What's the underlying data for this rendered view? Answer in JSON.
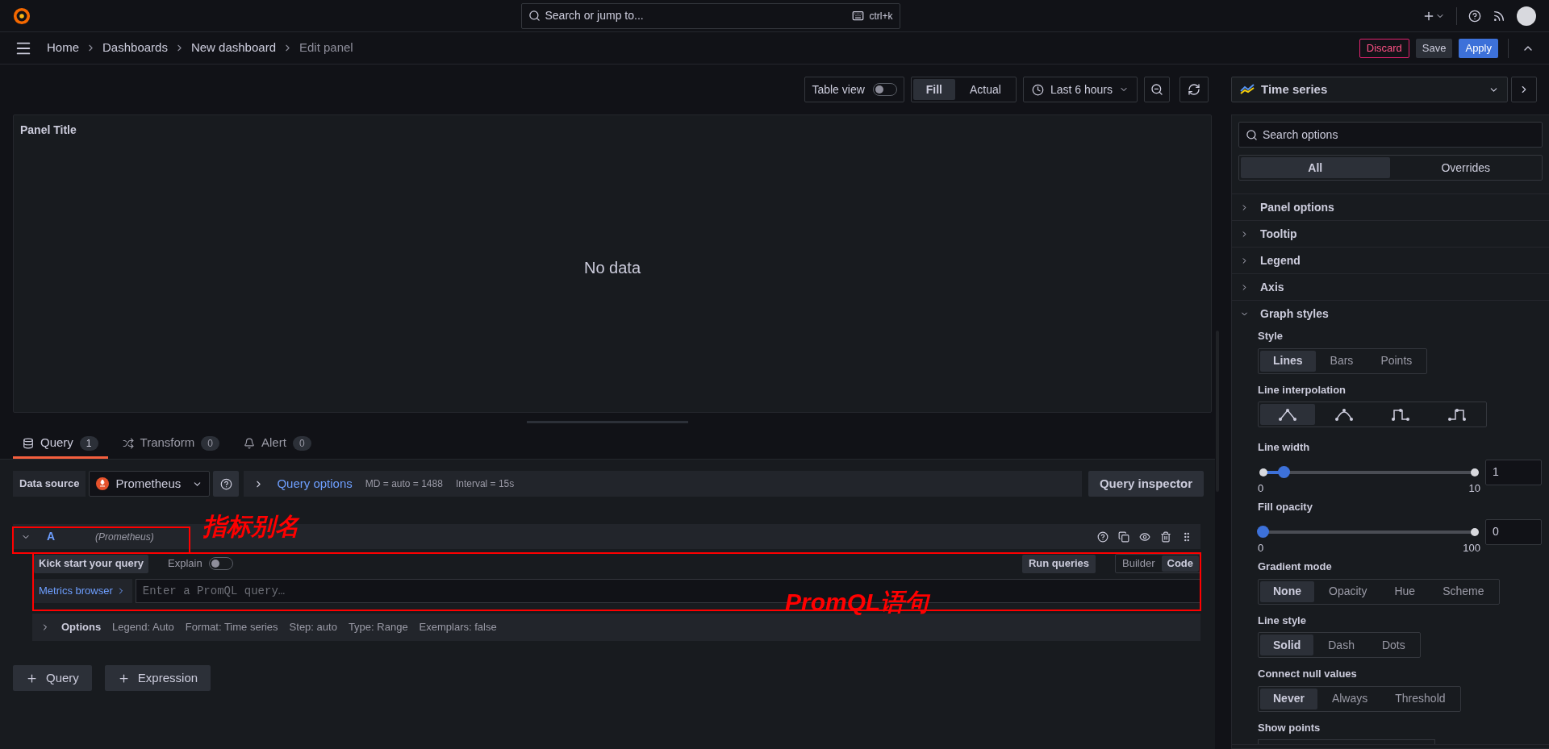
{
  "topbar": {
    "search_placeholder": "Search or jump to...",
    "shortcut": "ctrl+k"
  },
  "breadcrumb": [
    "Home",
    "Dashboards",
    "New dashboard",
    "Edit panel"
  ],
  "actions": [
    {
      "label": "Discard",
      "kind": "danger"
    },
    {
      "label": "Save",
      "kind": "secondary"
    },
    {
      "label": "Apply",
      "kind": "primary"
    }
  ],
  "toolbar": {
    "table_view": {
      "label": "Table view",
      "on": false
    },
    "fill_modes": [
      {
        "label": "Fill",
        "selected": true
      },
      {
        "label": "Actual",
        "selected": false
      }
    ],
    "time_range": "Last 6 hours"
  },
  "visualization": "Time series",
  "panel": {
    "title": "Panel Title",
    "message": "No data"
  },
  "query_tabs": [
    {
      "label": "Query",
      "count": "1",
      "kind": "query",
      "selected": true
    },
    {
      "label": "Transform",
      "count": "0",
      "kind": "transform",
      "selected": false
    },
    {
      "label": "Alert",
      "count": "0",
      "kind": "alert",
      "selected": false
    }
  ],
  "data_source": {
    "label": "Data source",
    "name": "Prometheus"
  },
  "query_options": {
    "label": "Query options",
    "md": "MD = auto = 1488",
    "interval": "Interval = 15s"
  },
  "query_inspector": "Query inspector",
  "query": {
    "ref": "A",
    "source": "(Prometheus)",
    "expanded": true,
    "kick_start": "Kick start your query",
    "explain": {
      "label": "Explain",
      "on": false
    },
    "run": "Run queries",
    "modes": [
      {
        "label": "Builder",
        "selected": false
      },
      {
        "label": "Code",
        "selected": true
      }
    ],
    "metrics_browser": "Metrics browser",
    "placeholder": "Enter a PromQL query…",
    "options_label": "Options",
    "options": [
      "Legend: Auto",
      "Format: Time series",
      "Step: auto",
      "Type: Range",
      "Exemplars: false"
    ]
  },
  "add_buttons": [
    "Query",
    "Expression"
  ],
  "options_pane": {
    "search_placeholder": "Search options",
    "tabs": [
      {
        "label": "All",
        "selected": true
      },
      {
        "label": "Overrides",
        "selected": false
      }
    ],
    "sections": [
      {
        "title": "Panel options",
        "expanded": false
      },
      {
        "title": "Tooltip",
        "expanded": false
      },
      {
        "title": "Legend",
        "expanded": false
      },
      {
        "title": "Axis",
        "expanded": false
      },
      {
        "title": "Graph styles",
        "expanded": true
      }
    ],
    "graph_styles": [
      {
        "kind": "radio",
        "label": "Style",
        "options": [
          {
            "label": "Lines",
            "selected": true
          },
          {
            "label": "Bars",
            "selected": false
          },
          {
            "label": "Points",
            "selected": false
          }
        ]
      },
      {
        "kind": "interpolation",
        "label": "Line interpolation",
        "options": [
          {
            "kind": "linear",
            "selected": true
          },
          {
            "kind": "smooth",
            "selected": false
          },
          {
            "kind": "step-before",
            "selected": false
          },
          {
            "kind": "step-after",
            "selected": false
          }
        ]
      },
      {
        "kind": "slider",
        "label": "Line width",
        "level": 0.1,
        "min": "0",
        "max": "10",
        "value": "1"
      },
      {
        "kind": "slider",
        "label": "Fill opacity",
        "level": 0,
        "min": "0",
        "max": "100",
        "value": "0"
      },
      {
        "kind": "radio",
        "label": "Gradient mode",
        "options": [
          {
            "label": "None",
            "selected": true
          },
          {
            "label": "Opacity",
            "selected": false
          },
          {
            "label": "Hue",
            "selected": false
          },
          {
            "label": "Scheme",
            "selected": false
          }
        ]
      },
      {
        "kind": "radio",
        "label": "Line style",
        "options": [
          {
            "label": "Solid",
            "selected": true
          },
          {
            "label": "Dash",
            "selected": false
          },
          {
            "label": "Dots",
            "selected": false
          }
        ]
      },
      {
        "kind": "radio",
        "label": "Connect null values",
        "options": [
          {
            "label": "Never",
            "selected": true
          },
          {
            "label": "Always",
            "selected": false
          },
          {
            "label": "Threshold",
            "selected": false
          }
        ]
      },
      {
        "kind": "cut",
        "label": "Show points"
      }
    ]
  },
  "annotations": [
    {
      "label": "指标别名",
      "kind": "alias"
    },
    {
      "label": "PromQL语句",
      "kind": "promql"
    }
  ]
}
